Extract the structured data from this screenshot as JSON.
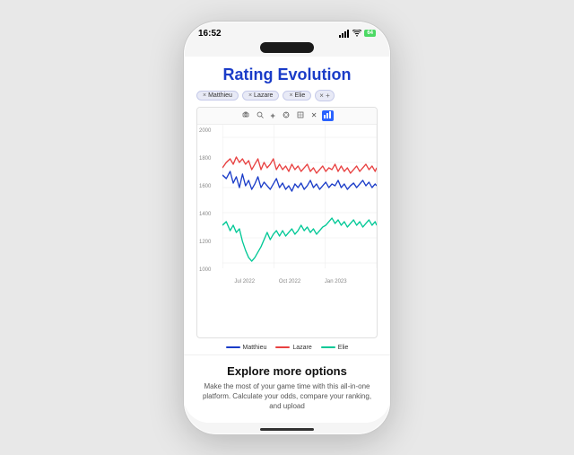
{
  "phone": {
    "time": "16:52",
    "battery_label": "64",
    "screen": {
      "title": "Rating Evolution",
      "filter_tags": [
        {
          "label": "Matthieu",
          "removable": true
        },
        {
          "label": "Lazare",
          "removable": true
        },
        {
          "label": "Elie",
          "removable": true
        }
      ],
      "chart": {
        "toolbar_tools": [
          "📷",
          "🔍",
          "+",
          "⊕",
          "⊞",
          "✕",
          "📊"
        ],
        "y_labels": [
          "2000",
          "1800",
          "1600",
          "1400",
          "1200",
          "1000"
        ],
        "x_labels": [
          "Jul 2022",
          "Oct 2022",
          "Jan 2023"
        ],
        "legend": [
          {
            "name": "Matthieu",
            "color": "#1a3cc8"
          },
          {
            "name": "Lazare",
            "color": "#e84040"
          },
          {
            "name": "Elie",
            "color": "#00c896"
          }
        ]
      },
      "explore": {
        "title": "Explore more options",
        "text": "Make the most of your game time with this all-in-one platform. Calculate your odds, compare your ranking, and upload"
      }
    }
  }
}
